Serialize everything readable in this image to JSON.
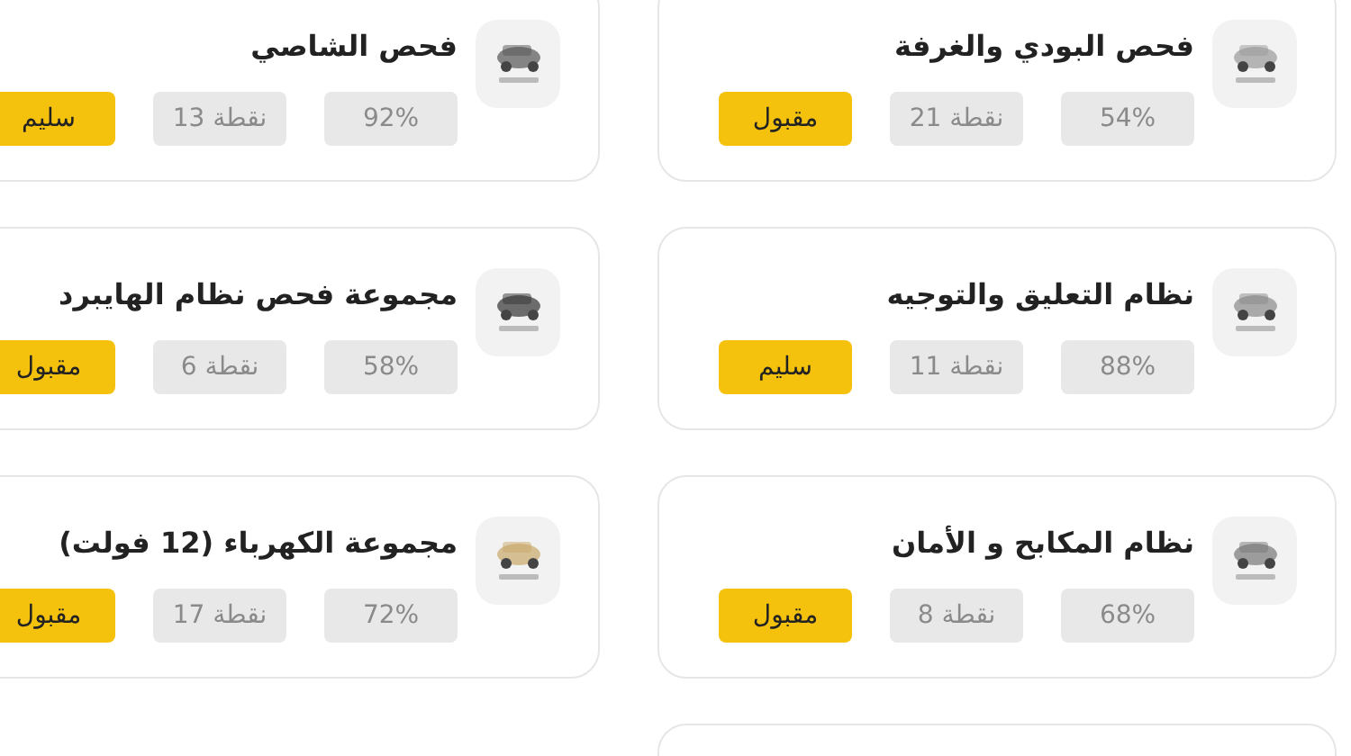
{
  "cards": [
    {
      "title": "فحص البودي والغرفة",
      "percent": "54%",
      "points": "نقطة 21",
      "status": "مقبول"
    },
    {
      "title": "فحص الشاصي",
      "percent": "92%",
      "points": "نقطة 13",
      "status": "سليم"
    },
    {
      "title": "نظام التعليق والتوجيه",
      "percent": "88%",
      "points": "نقطة 11",
      "status": "سليم"
    },
    {
      "title": "مجموعة فحص نظام الهايبرد",
      "percent": "58%",
      "points": "نقطة 6",
      "status": "مقبول"
    },
    {
      "title": "نظام المكابح و الأمان",
      "percent": "68%",
      "points": "نقطة 8",
      "status": "مقبول"
    },
    {
      "title": "مجموعة الكهرباء (12 فولت)",
      "percent": "72%",
      "points": "نقطة 17",
      "status": "مقبول"
    }
  ]
}
